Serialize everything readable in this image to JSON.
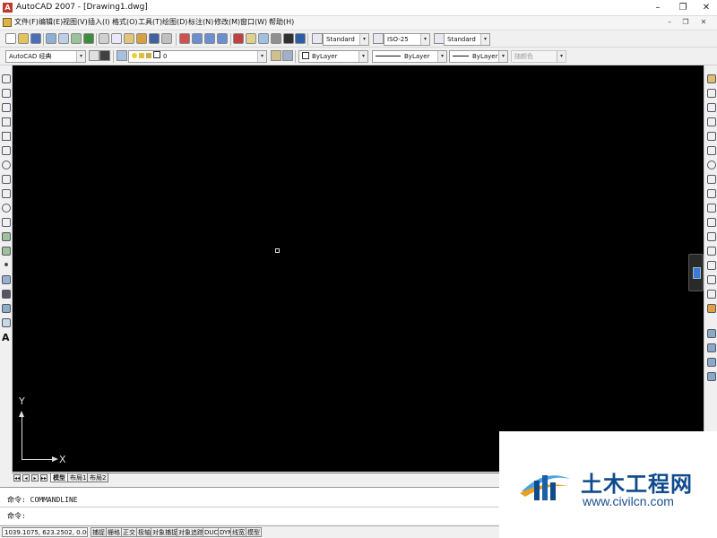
{
  "window": {
    "title": "AutoCAD 2007 - [Drawing1.dwg]",
    "minimize": "–",
    "restore": "❐",
    "close": "✕"
  },
  "menu": {
    "items": [
      "文件(F)",
      "编辑(E)",
      "视图(V)",
      "插入(I)",
      "格式(O)",
      "工具(T)",
      "绘图(D)",
      "标注(N)",
      "修改(M)",
      "窗口(W)",
      "帮助(H)"
    ],
    "mdi_minimize": "–",
    "mdi_restore": "❐",
    "mdi_close": "✕"
  },
  "toolbar": {
    "text_style": "Standard",
    "dim_style": "ISO-25",
    "table_style": "Standard",
    "workspace": "AutoCAD 经典",
    "layer": "0",
    "color": "ByLayer",
    "linetype": "ByLayer",
    "lineweight": "ByLayer",
    "plot_style": "随颜色",
    "arrow": "▾"
  },
  "draw_tools": {
    "text_tool": "A"
  },
  "ucs": {
    "x_label": "X",
    "y_label": "Y"
  },
  "layout_tabs": {
    "nav": [
      "◂◂",
      "◂",
      "▸",
      "▸▸"
    ],
    "tabs": [
      "模型",
      "布局1",
      "布局2"
    ],
    "active": "模型"
  },
  "command": {
    "history": "命令: COMMANDLINE",
    "prompt": "命令:"
  },
  "status": {
    "coordinates": "1039.1075, 623.2502, 0.0000",
    "toggles": [
      "捕捉",
      "栅格",
      "正交",
      "极轴",
      "对象捕捉",
      "对象追踪",
      "DUCS",
      "DYN",
      "线宽",
      "模型"
    ]
  },
  "watermark": {
    "site_name": "土木工程网",
    "url": "www.civilcn.com"
  },
  "colors": {
    "canvas": "#000000",
    "chrome": "#f0f0f0",
    "watermark_blue": "#0f4a8c"
  }
}
